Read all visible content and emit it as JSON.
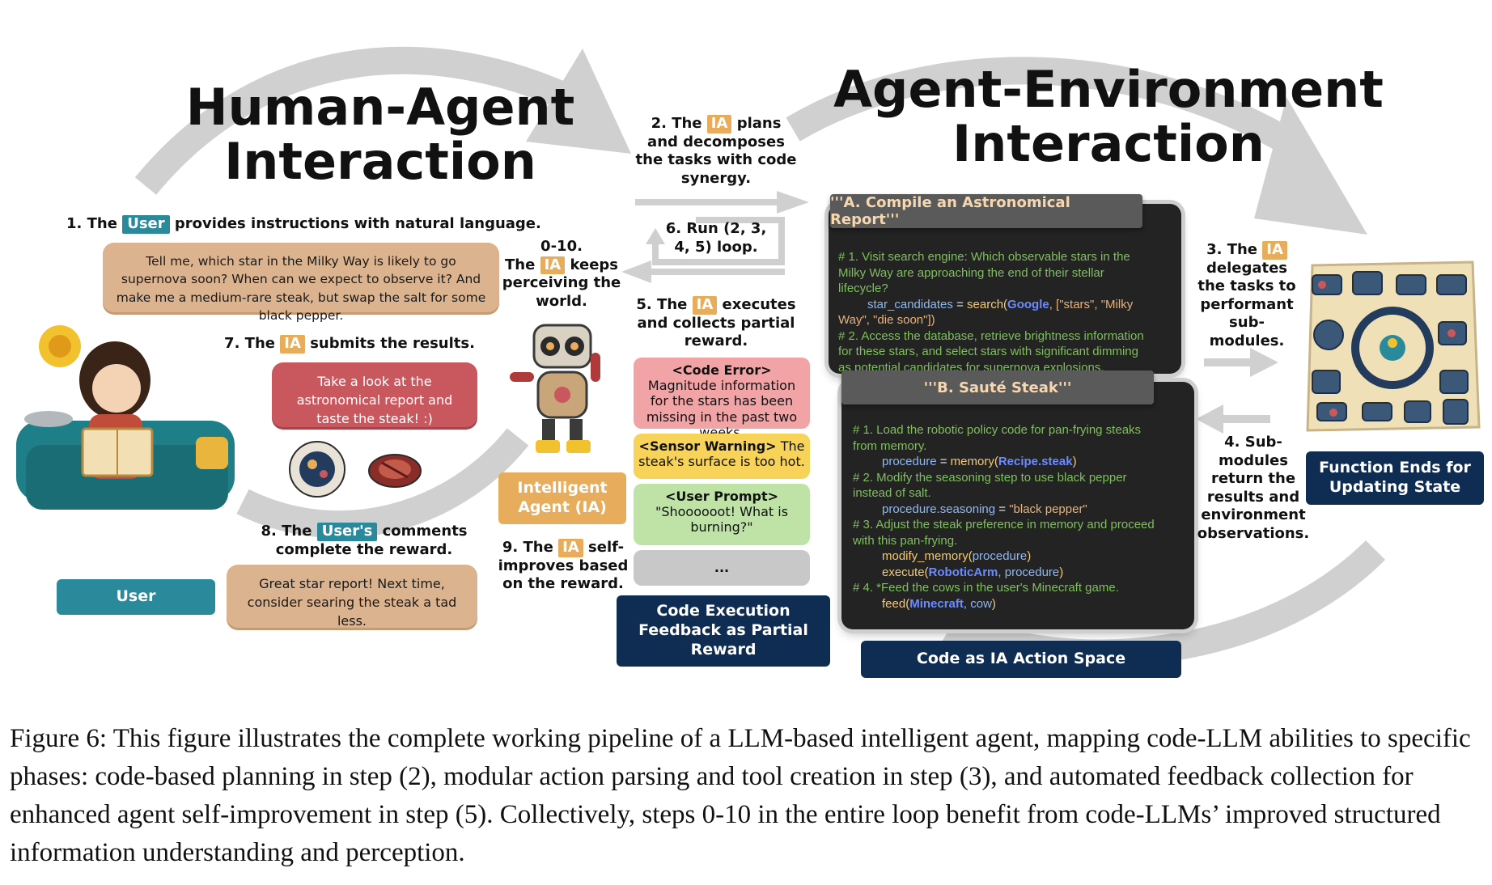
{
  "titles": {
    "human_agent": [
      "Human-Agent",
      "Interaction"
    ],
    "agent_env": [
      "Agent-Environment",
      "Interaction"
    ]
  },
  "steps": {
    "s1": {
      "prefix": "1. The",
      "tag": "User",
      "suffix": "provides instructions with natural language."
    },
    "s0_10": {
      "line1": "0-10.",
      "pre": "The",
      "tag": "IA",
      "post": "keeps",
      "line3": "perceiving the",
      "line4": "world."
    },
    "s2": {
      "prefix": "2. The",
      "tag": "IA",
      "suffix": "plans",
      "line2": "and decomposes",
      "line3": "the tasks with code",
      "line4": "synergy."
    },
    "s6": {
      "line1": "6. Run (2, 3,",
      "line2": "4, 5) loop."
    },
    "s5": {
      "prefix": "5. The",
      "tag": "IA",
      "suffix": "executes",
      "line2": "and collects partial",
      "line3": "reward."
    },
    "s7": {
      "prefix": "7. The",
      "tag": "IA",
      "suffix": "submits the results."
    },
    "s8": {
      "prefix": "8. The",
      "tag": "User's",
      "suffix": "comments",
      "line2": "complete the reward."
    },
    "s9": {
      "prefix": "9. The",
      "tag": "IA",
      "suffix": "self-",
      "line2": "improves based",
      "line3": "on the reward."
    },
    "s3": {
      "prefix": "3. The",
      "tag": "IA",
      "line2": "delegates",
      "line3": "the tasks to",
      "line4": "performant",
      "line5": "sub-",
      "line6": "modules."
    },
    "s4": {
      "line1": "4. Sub-",
      "line2": "modules",
      "line3": "return the",
      "line4": "results and",
      "line5": "environment",
      "line6": "observations."
    }
  },
  "bubbles": {
    "user_request": "Tell me, which star in the Milky Way is likely to go supernova soon? When can we expect to observe it? And make me a medium-rare steak, but swap the salt for some black pepper.",
    "ia_submit": "Take a look at the astronomical report and taste the steak! :)",
    "user_feedback": "Great star report! Next time, consider searing the steak a tad less."
  },
  "labels": {
    "user": "User",
    "agent": "Intelligent Agent (IA)",
    "code_exec": "Code Execution Feedback as Partial Reward",
    "action_space": "Code as IA Action Space",
    "function_ends": "Function Ends for Updating State"
  },
  "feedback": [
    {
      "tag": "<Code Error>",
      "text": "Magnitude information for the stars has been missing in the past two weeks.",
      "color": "#f2a3a5"
    },
    {
      "tag": "<Sensor Warning>",
      "text": "The steak's surface is too hot.",
      "color": "#f7d35a"
    },
    {
      "tag": "<User Prompt>",
      "text": "\"Shoooooot! What is burning?\"",
      "color": "#bfe3a6"
    },
    {
      "tag": "",
      "text": "...",
      "color": "#c8c8c8"
    }
  ],
  "code_a": {
    "title": "'''A. Compile an Astronomical Report'''",
    "l1": "# 1. Visit search engine: Which observable stars in the",
    "l2": "Milky Way are approaching the end of their stellar",
    "l3": "lifecycle?",
    "l4_var": "star_candidates",
    "l4_eq": " = ",
    "l4_fn": "search(",
    "l4_obj": "Google",
    "l4_arg": ", [\"stars\", \"Milky",
    "l5": "Way\", \"die soon\"])",
    "l6": "# 2. Access the database, retrieve brightness information",
    "l7": "for these stars, and select stars with significant dimming",
    "l8": "as potential candidates for supernova explosions."
  },
  "code_b": {
    "title": "'''B. Sauté Steak'''",
    "l1": "# 1. Load the robotic policy code for pan-frying steaks",
    "l2": "from memory.",
    "l3_var": "procedure",
    "l3_eq": " = ",
    "l3_fn": "memory(",
    "l3_obj": "Recipe.steak",
    "l3_end": ")",
    "l4": "# 2. Modify the seasoning step to use black pepper",
    "l5": "instead of salt.",
    "l6_var": "procedure.seasoning",
    "l6_eq": " = ",
    "l6_str": "\"black pepper\"",
    "l7": "# 3. Adjust the steak preference in memory and proceed",
    "l8": "with this pan-frying.",
    "l9_fn": "modify_memory(",
    "l9_var": "procedure",
    "l9_end": ")",
    "l10_fn": "execute(",
    "l10_obj": "RoboticArm",
    "l10_var": ", procedure",
    "l10_end": ")",
    "l11": "# 4. *Feed the cows in the user's Minecraft game.",
    "l12_fn": "feed(",
    "l12_obj": "Minecraft",
    "l12_var": ", cow",
    "l12_end": ")"
  },
  "caption": "Figure 6:  This figure illustrates the complete working pipeline of a LLM-based intelligent agent, mapping code-LLM abilities to specific phases: code-based planning in step (2), modular action parsing and tool creation in step (3), and automated feedback collection for enhanced agent self-improvement in step (5). Collectively, steps 0-10 in the entire loop benefit from code-LLMs’ improved structured information understanding and perception.",
  "colors": {
    "teal": "#2a8a9c",
    "navy": "#0f2d52",
    "ia_orange": "#e7ad5c",
    "arrow_gray": "#cfcfcf"
  }
}
